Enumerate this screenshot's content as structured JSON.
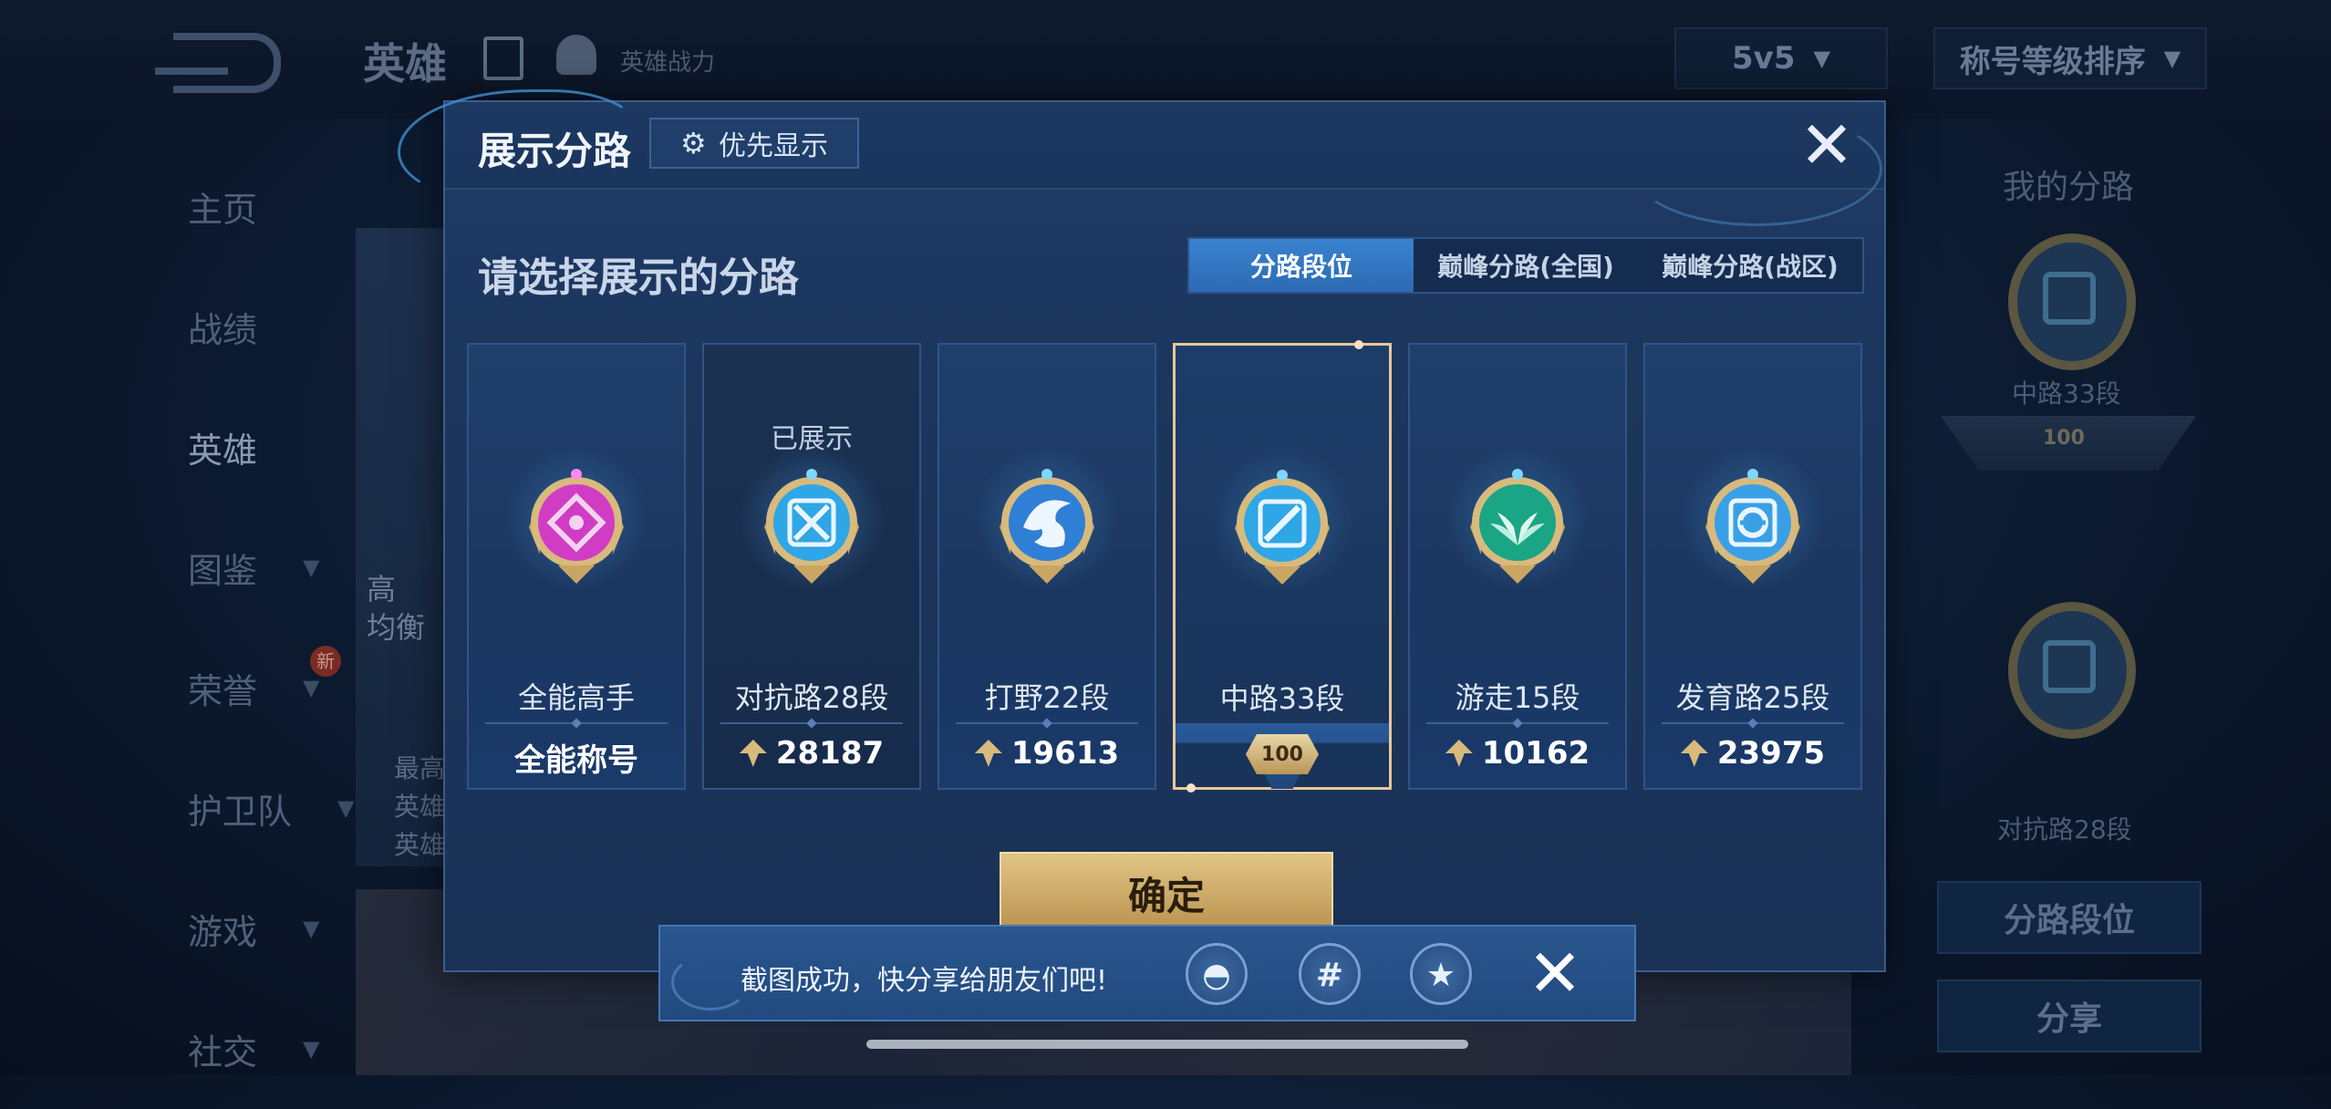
{
  "background": {
    "title": "英雄",
    "subtitle": "英雄战力",
    "mode_dropdown": "5v5",
    "sort_dropdown": "称号等级排序",
    "nav": [
      {
        "label": "主页"
      },
      {
        "label": "战绩"
      },
      {
        "label": "英雄"
      },
      {
        "label": "图鉴"
      },
      {
        "label": "荣誉"
      },
      {
        "label": "护卫队"
      },
      {
        "label": "游戏"
      },
      {
        "label": "社交"
      }
    ],
    "new_badge": "新",
    "card_text_1": "高",
    "card_text_2": "均衡",
    "card_text_3": "最高",
    "card_text_4": "英雄",
    "card_text_5": "英雄",
    "right_title": "我的分路",
    "right_badge_1_label": "中路33段",
    "right_badge_1_num": "100",
    "right_badge_2_label": "对抗路28段",
    "right_btn_1": "分路段位",
    "right_btn_2": "分享"
  },
  "modal": {
    "title": "展示分路",
    "priority_label": "优先显示",
    "prompt": "请选择展示的分路",
    "tabs": [
      {
        "label": "分路段位",
        "active": true
      },
      {
        "label": "巅峰分路(全国)",
        "active": false
      },
      {
        "label": "巅峰分路(战区)",
        "active": false
      }
    ],
    "cards": [
      {
        "name": "全能高手",
        "value": "全能称号",
        "shown": "",
        "emblem_color": "#d13cc4"
      },
      {
        "name": "对抗路28段",
        "value": "28187",
        "shown": "已展示",
        "emblem_color": "#2fa6e6"
      },
      {
        "name": "打野22段",
        "value": "19613",
        "shown": "",
        "emblem_color": "#2f7fd6"
      },
      {
        "name": "中路33段",
        "value": "100",
        "shown": "",
        "emblem_color": "#2fa6e6"
      },
      {
        "name": "游走15段",
        "value": "10162",
        "shown": "",
        "emblem_color": "#1aa585"
      },
      {
        "name": "发育路25段",
        "value": "23975",
        "shown": "",
        "emblem_color": "#3aa0e6"
      }
    ],
    "confirm_label": "确定"
  },
  "toast": {
    "text": "截图成功，快分享给朋友们吧!",
    "icons": [
      "qq-icon",
      "wechat-moments-icon",
      "qzone-icon"
    ]
  },
  "colors": {
    "gold": "#d8ba7c",
    "tab_active": "#2c6ab3",
    "modal_bg": "#1c355b"
  }
}
